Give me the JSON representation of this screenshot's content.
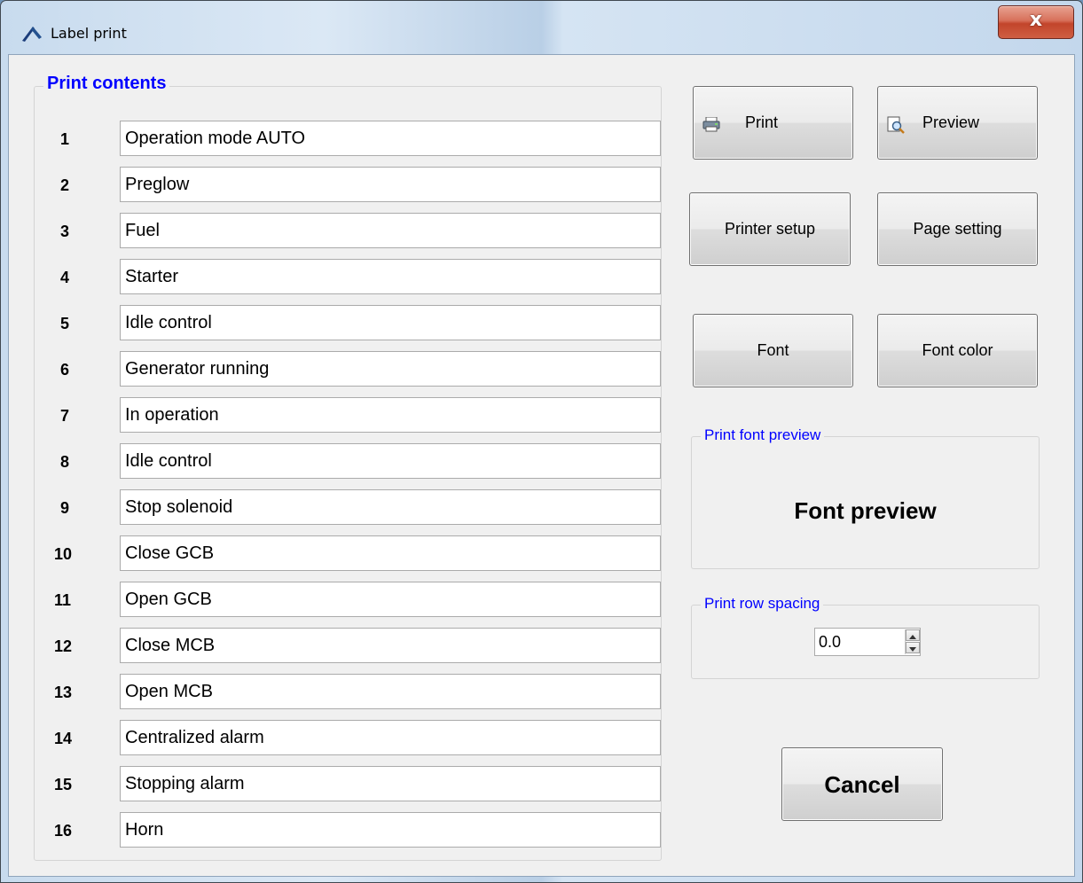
{
  "window": {
    "title": "Label print",
    "close_glyph": "x"
  },
  "print_contents": {
    "label": "Print contents",
    "rows": [
      {
        "num": "1",
        "value": "Operation mode AUTO"
      },
      {
        "num": "2",
        "value": "Preglow"
      },
      {
        "num": "3",
        "value": "Fuel"
      },
      {
        "num": "4",
        "value": "Starter"
      },
      {
        "num": "5",
        "value": "Idle control"
      },
      {
        "num": "6",
        "value": "Generator running"
      },
      {
        "num": "7",
        "value": "In operation"
      },
      {
        "num": "8",
        "value": "Idle control"
      },
      {
        "num": "9",
        "value": "Stop solenoid"
      },
      {
        "num": "10",
        "value": "Close GCB"
      },
      {
        "num": "11",
        "value": "Open GCB"
      },
      {
        "num": "12",
        "value": "Close MCB"
      },
      {
        "num": "13",
        "value": "Open MCB"
      },
      {
        "num": "14",
        "value": "Centralized alarm"
      },
      {
        "num": "15",
        "value": "Stopping alarm"
      },
      {
        "num": "16",
        "value": "Horn"
      }
    ]
  },
  "buttons": {
    "print": "Print",
    "preview": "Preview",
    "printer_setup": "Printer setup",
    "page_setting": "Page setting",
    "font": "Font",
    "font_color": "Font color",
    "cancel": "Cancel"
  },
  "font_preview_group": {
    "label": "Print font preview",
    "sample": "Font preview"
  },
  "row_spacing_group": {
    "label": "Print row spacing",
    "value": "0.0"
  },
  "icons": {
    "app": "label-print-app-icon",
    "print": "printer-icon",
    "preview": "magnifier-page-icon",
    "spin_up": "arrow-up-icon",
    "spin_down": "arrow-down-icon"
  },
  "colors": {
    "group_label": "#0000ff",
    "close_button": "#c7503a",
    "dialog_bg": "#f0f0f0"
  }
}
